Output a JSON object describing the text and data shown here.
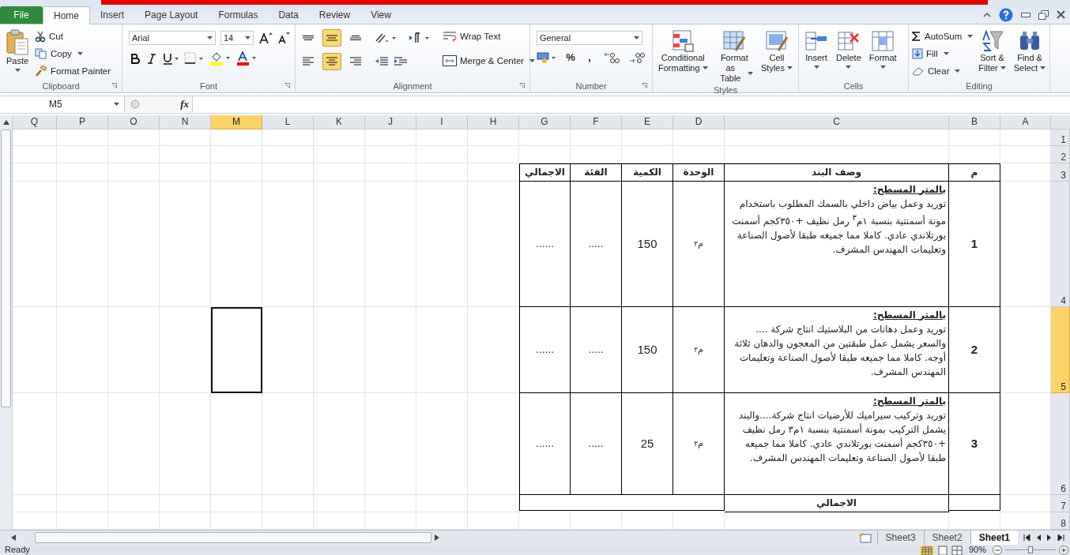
{
  "ribbon_tabs": [
    {
      "label": "File",
      "kind": "file",
      "selected": false
    },
    {
      "label": "Home",
      "kind": "tab",
      "selected": true
    },
    {
      "label": "Insert",
      "kind": "tab",
      "selected": false
    },
    {
      "label": "Page Layout",
      "kind": "tab",
      "selected": false
    },
    {
      "label": "Formulas",
      "kind": "tab",
      "selected": false
    },
    {
      "label": "Data",
      "kind": "tab",
      "selected": false
    },
    {
      "label": "Review",
      "kind": "tab",
      "selected": false
    },
    {
      "label": "View",
      "kind": "tab",
      "selected": false
    }
  ],
  "clipboard": {
    "label": "Clipboard",
    "paste": "Paste",
    "cut": "Cut",
    "copy": "Copy",
    "format_painter": "Format Painter"
  },
  "font": {
    "label": "Font",
    "name": "Arial",
    "size": "14"
  },
  "alignment": {
    "label": "Alignment",
    "vertical": [
      {
        "selected": false
      },
      {
        "selected": true
      },
      {
        "selected": false
      }
    ],
    "horizontal": [
      {
        "selected": false
      },
      {
        "selected": true
      },
      {
        "selected": false
      }
    ],
    "wrap_text": "Wrap Text",
    "merge": "Merge & Center"
  },
  "number": {
    "label": "Number",
    "format": "General",
    "percent": "%",
    "comma": ","
  },
  "styles": {
    "label": "Styles",
    "buttons": [
      {
        "line1": "Conditional",
        "line2": "Formatting"
      },
      {
        "line1": "Format",
        "line2": "as Table"
      },
      {
        "line1": "Cell",
        "line2": "Styles"
      }
    ]
  },
  "cells": {
    "label": "Cells",
    "buttons": [
      "Insert",
      "Delete",
      "Format"
    ]
  },
  "editing": {
    "label": "Editing",
    "autosum": "AutoSum",
    "fill": "Fill",
    "clear": "Clear",
    "buttons": [
      {
        "line1": "Sort &",
        "line2": "Filter"
      },
      {
        "line1": "Find &",
        "line2": "Select"
      }
    ]
  },
  "name_box": "M5",
  "function_label": "fx",
  "columns": [
    {
      "label": "Q",
      "selected": false
    },
    {
      "label": "P",
      "selected": false
    },
    {
      "label": "O",
      "selected": false
    },
    {
      "label": "N",
      "selected": false
    },
    {
      "label": "M",
      "selected": true
    },
    {
      "label": "L",
      "selected": false
    },
    {
      "label": "K",
      "selected": false
    },
    {
      "label": "J",
      "selected": false
    },
    {
      "label": "I",
      "selected": false
    },
    {
      "label": "H",
      "selected": false
    },
    {
      "label": "G",
      "selected": false
    },
    {
      "label": "F",
      "selected": false
    },
    {
      "label": "E",
      "selected": false
    },
    {
      "label": "D",
      "selected": false
    },
    {
      "label": "C",
      "selected": false
    },
    {
      "label": "B",
      "selected": false
    },
    {
      "label": "A",
      "selected": false
    }
  ],
  "rows": [
    {
      "label": "1",
      "selected": false
    },
    {
      "label": "2",
      "selected": false
    },
    {
      "label": "3",
      "selected": false
    },
    {
      "label": "4",
      "selected": false
    },
    {
      "label": "5",
      "selected": true
    },
    {
      "label": "6",
      "selected": false
    },
    {
      "label": "7",
      "selected": false
    },
    {
      "label": "8",
      "selected": false
    }
  ],
  "table": {
    "headers": [
      "م",
      "وصف البند",
      "الوحدة",
      "الكمية",
      "الفئة",
      "الاجمالي"
    ],
    "items": [
      {
        "no": "1",
        "heading": "بالمتر المسطح:",
        "description": "توريد وعمل بياض داخلي بالسمك المطلوب باستخدام مونة أسمنتية بنسبة ١م$^{٣}$ رمل نظيف +٣٥٠كجم أسمنت بورتلاندي عادي. كاملا مما جميعه طبقا لأصول الصناعة وتعليمات المهندس المشرف.",
        "unit": "م$^{٢}$",
        "quantity": "150",
        "rate": ".....",
        "total": "......"
      },
      {
        "no": "2",
        "heading": "بالمتر المسطح:",
        "description": "توريد وعمل دهانات من البلاستيك انتاج شركة .... والسعر يشمل عمل طبقتين من المعجون والدهان ثلاثة أوجه. كاملا مما جميعه طبقا لأصول الصناعة وتعليمات المهندس المشرف.",
        "unit": "م$^{٢}$",
        "quantity": "150",
        "rate": ".....",
        "total": "......"
      },
      {
        "no": "3",
        "heading": "بالمتر المسطح:",
        "description": "توريد وتركيب سيراميك للأرضيات انتاج شركة....والبند يشمل التركيب بمونة أسمنتية بنسبة ١م٣ رمل نظيف +٣٥٠كجم أسمنت بورتلاندي عادي. كاملا مما جميعه طبقا لأصول الصناعة وتعليمات المهندس المشرف.",
        "unit": "م$^{٢}$",
        "quantity": "25",
        "rate": ".....",
        "total": "......"
      }
    ],
    "total_label": "الاجمالي"
  },
  "sheet_tabs": [
    {
      "label": "Sheet3",
      "selected": false
    },
    {
      "label": "Sheet2",
      "selected": false
    },
    {
      "label": "Sheet1",
      "selected": true
    }
  ],
  "status": {
    "text": "Ready",
    "zoom": "90%",
    "level": 0.5
  }
}
